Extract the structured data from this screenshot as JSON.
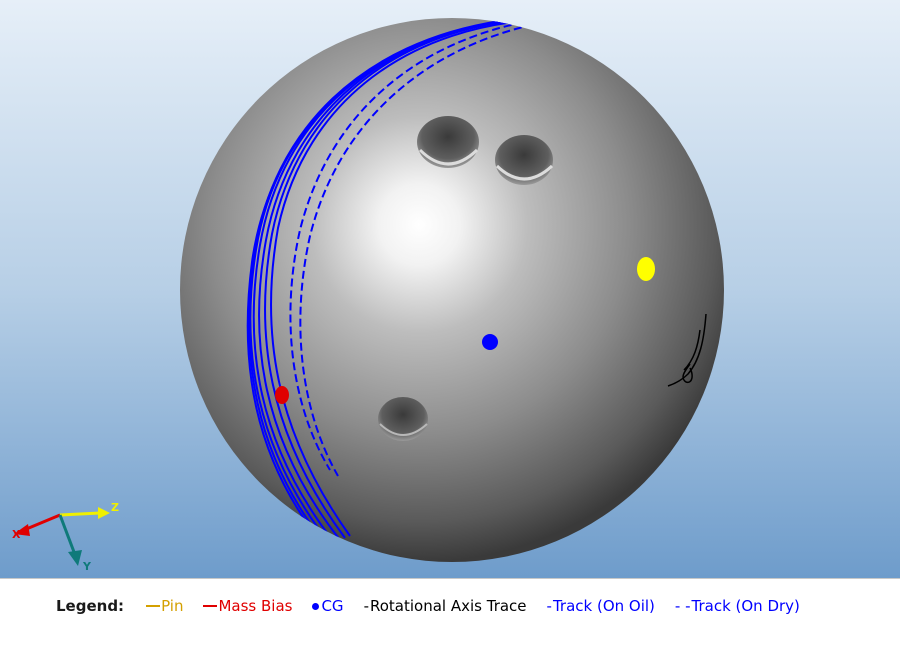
{
  "colors": {
    "background_top": "#e6eff8",
    "background_bottom": "#6e9ccb",
    "ball": "#8a8a8a",
    "pin": "#ffff00",
    "mass_bias": "#e00000",
    "cg": "#0000ff",
    "axis_trace": "#000000",
    "track": "#0000ff",
    "axis_x": "#e00000",
    "axis_y": "#0f7a7a",
    "axis_z": "#ffff00"
  },
  "axes": {
    "x_label": "X",
    "y_label": "Y",
    "z_label": "Z"
  },
  "legend": {
    "title": "Legend:",
    "items": [
      {
        "name": "pin",
        "symbol": "line",
        "label": "Pin",
        "color": "#d4a000"
      },
      {
        "name": "mass-bias",
        "symbol": "line",
        "label": "Mass Bias",
        "color": "#e00000"
      },
      {
        "name": "cg",
        "symbol": "dot",
        "label": "CG",
        "color": "#0000ff"
      },
      {
        "name": "rotational-axis-trace",
        "symbol": "text-dash",
        "label": "Rotational Axis Trace",
        "color": "#000000"
      },
      {
        "name": "track-on-oil",
        "symbol": "text-dash",
        "label": "Track (On Oil)",
        "color": "#0000ff"
      },
      {
        "name": "track-on-dry",
        "symbol": "text-double-dash",
        "label": "Track (On Dry)",
        "color": "#0000ff"
      }
    ]
  }
}
